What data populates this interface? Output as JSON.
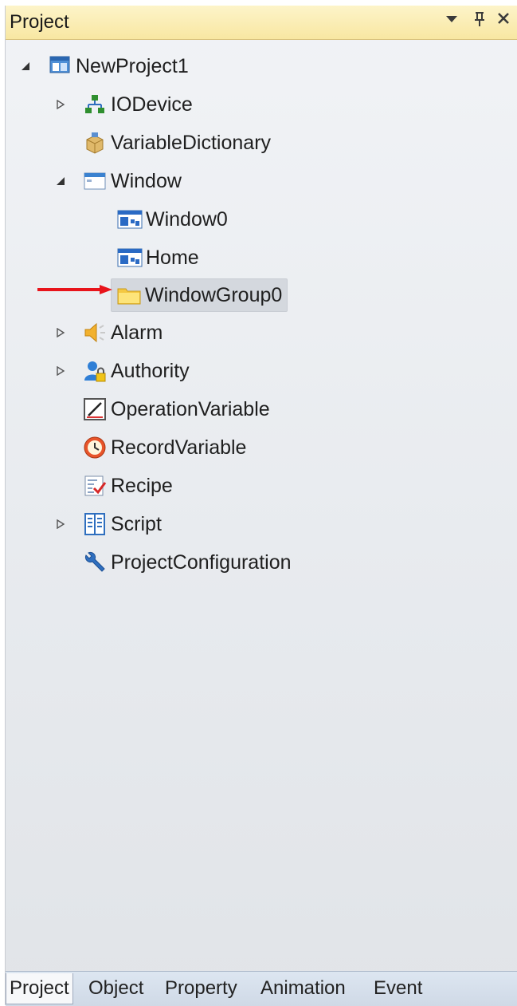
{
  "panel": {
    "title": "Project",
    "controls": [
      "dropdown-icon",
      "pin-icon",
      "close-icon"
    ]
  },
  "tree": {
    "root": "NewProject1",
    "items": [
      {
        "label": "IODevice",
        "icon": "network-icon",
        "expander": "collapsed"
      },
      {
        "label": "VariableDictionary",
        "icon": "package-icon",
        "expander": "none"
      },
      {
        "label": "Window",
        "icon": "window-icon",
        "expander": "expanded"
      },
      {
        "label": "Window0",
        "icon": "window-screen-icon",
        "expander": "none"
      },
      {
        "label": "Home",
        "icon": "window-screen-icon",
        "expander": "none"
      },
      {
        "label": "WindowGroup0",
        "icon": "folder-icon",
        "expander": "none",
        "selected": true
      },
      {
        "label": "Alarm",
        "icon": "alarm-speaker-icon",
        "expander": "collapsed"
      },
      {
        "label": "Authority",
        "icon": "user-lock-icon",
        "expander": "collapsed"
      },
      {
        "label": "OperationVariable",
        "icon": "pen-edit-icon",
        "expander": "none"
      },
      {
        "label": "RecordVariable",
        "icon": "clock-record-icon",
        "expander": "none"
      },
      {
        "label": "Recipe",
        "icon": "checklist-icon",
        "expander": "none"
      },
      {
        "label": "Script",
        "icon": "script-book-icon",
        "expander": "collapsed"
      },
      {
        "label": "ProjectConfiguration",
        "icon": "wrench-icon",
        "expander": "none"
      }
    ]
  },
  "tabs": [
    "Project",
    "Object",
    "Property",
    "Animation",
    "Event"
  ],
  "active_tab": "Project",
  "colors": {
    "title_bar": "#f8e7a2",
    "selection": "#d4d8de",
    "annotation_arrow": "#e8141b"
  }
}
